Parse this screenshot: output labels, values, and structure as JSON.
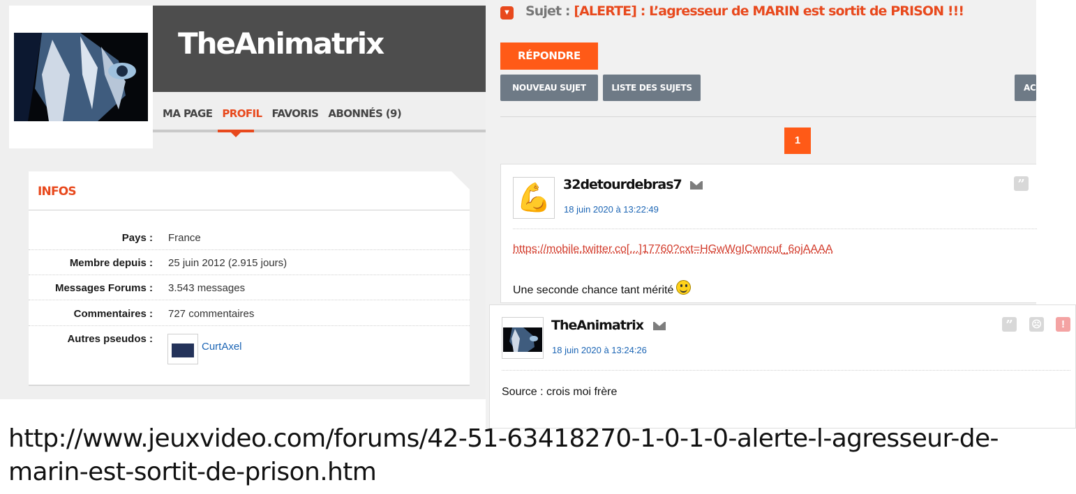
{
  "profile": {
    "username": "TheAnimatrix",
    "nav": [
      "MA PAGE",
      "PROFIL",
      "FAVORIS",
      "ABONNÉS (9)"
    ],
    "active_nav": "PROFIL",
    "infos_title": "INFOS",
    "rows": [
      {
        "label": "Pays :",
        "value": "France"
      },
      {
        "label": "Membre depuis :",
        "value": "25 juin 2012 (2.915 jours)"
      },
      {
        "label": "Messages Forums :",
        "value": "3.543 messages"
      },
      {
        "label": "Commentaires :",
        "value": "727 commentaires"
      },
      {
        "label": "Autres pseudos :",
        "value": "CurtAxel"
      }
    ]
  },
  "forum": {
    "topic_label": "Sujet :",
    "topic_title": "[ALERTE] : L’agresseur de MARIN est sortit de PRISON !!!",
    "reply_button": "RÉPONDRE",
    "new_topic_button": "NOUVEAU SUJET",
    "topic_list_button": "LISTE DES SUJETS",
    "ac_button": "AC",
    "current_page": "1",
    "posts": [
      {
        "author": "32detourdebras7",
        "date": "18 juin 2020 à 13:22:49",
        "avatar_emoji": "💪",
        "link": "https://mobile.twitter.co[...]17760?cxt=HGwWgICwncuf_6ojAAAA",
        "text": "Une seconde chance tant mérité"
      },
      {
        "author": "TheAnimatrix",
        "date": "18 juin 2020 à 13:24:26",
        "text": "Source : crois moi frère"
      }
    ],
    "icons": {
      "quote": "quote-icon",
      "mail": "mail-icon",
      "sad": "sad-face-icon",
      "alert": "alert-icon",
      "smiley": "smiley-icon"
    }
  },
  "caption": {
    "url": "http://www.jeuxvideo.com/forums/42-51-63418270-1-0-1-0-alerte-l-agresseur-de-marin-est-sortit-de-prison.htm"
  },
  "colors": {
    "accent": "#e8491d",
    "button_orange": "#ff5a17",
    "button_grey": "#6e7a86",
    "link_blue": "#1a64b4",
    "banner_dark": "#4d4d4d"
  }
}
